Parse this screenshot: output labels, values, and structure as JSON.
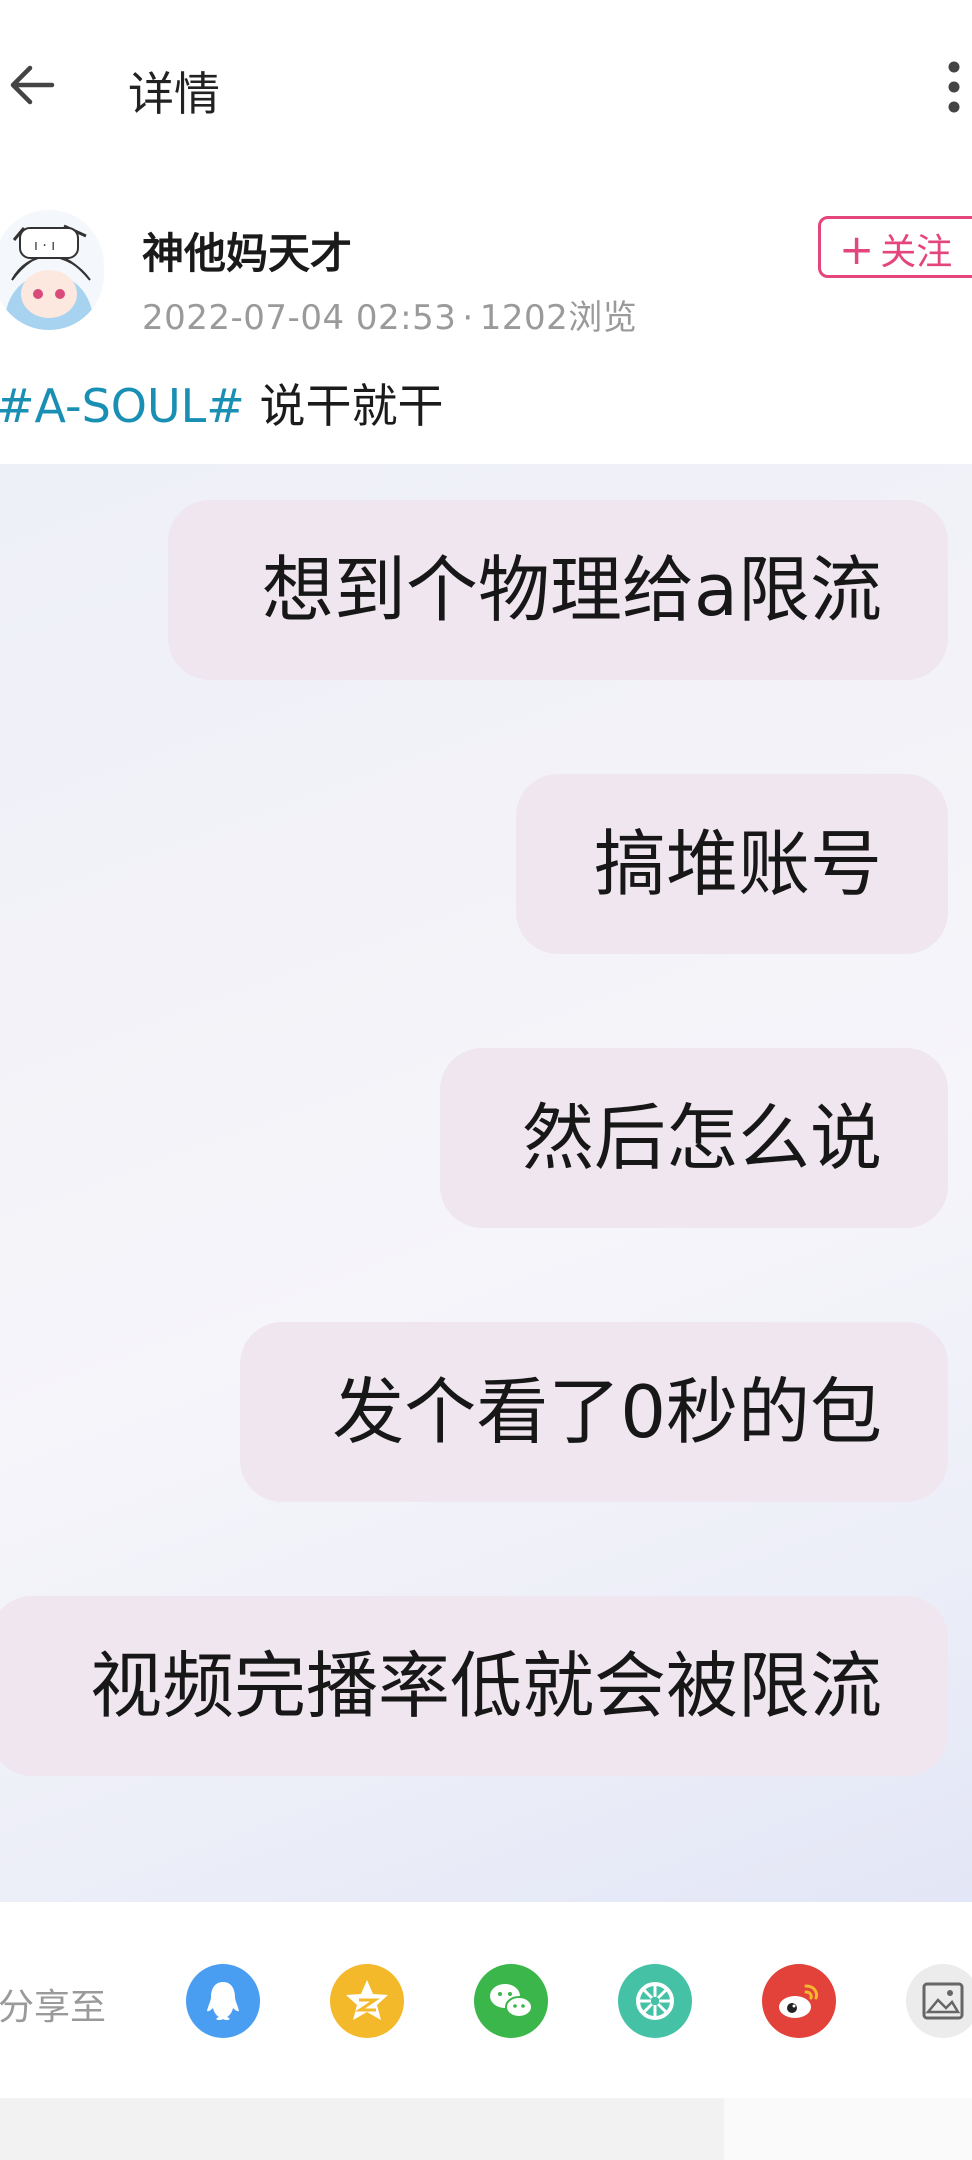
{
  "header": {
    "title": "详情"
  },
  "author": {
    "name": "神他妈天才",
    "timestamp": "2022-07-04 02:53",
    "separator": "·",
    "views": "1202浏览",
    "follow_label": "关注"
  },
  "post": {
    "hashtag": "#A-SOUL#",
    "text": "说干就干"
  },
  "image_bubbles": [
    "想到个物理给a限流",
    "搞堆账号",
    "然后怎么说",
    "发个看了0秒的包",
    "视频完播率低就会被限流"
  ],
  "share": {
    "label": "分享至",
    "targets": [
      "qq-icon",
      "qzone-icon",
      "wechat-icon",
      "moments-icon",
      "weibo-icon",
      "save-image-icon"
    ]
  },
  "colors": {
    "accent_pink": "#e3457c",
    "hashtag_blue": "#1a8fb4",
    "meta_gray": "#9a9a9a",
    "qq_blue": "#4a9ef2",
    "qzone_yellow": "#f3b92b",
    "wechat_green": "#3bb64a",
    "moments_teal": "#45c2a6",
    "weibo_red": "#e3423a"
  }
}
